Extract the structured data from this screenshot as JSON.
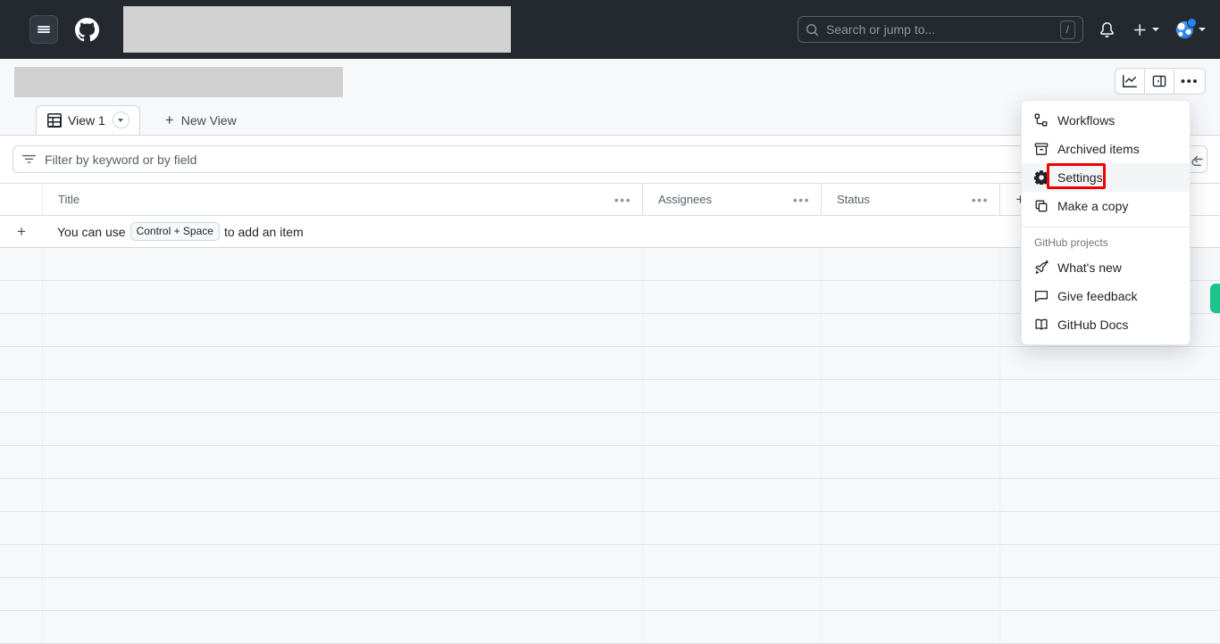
{
  "header": {
    "hamburger_icon": "hamburger-menu-icon",
    "logo_icon": "github-logo-icon",
    "org_name_redacted": "",
    "search": {
      "placeholder": "Search or jump to...",
      "shortcut": "/",
      "icon": "search-icon"
    },
    "notifications_icon": "bell-icon",
    "create_new_icon": "plus-icon",
    "avatar_icon": "avatar",
    "avatar_has_unread_dot": true
  },
  "project": {
    "name_redacted": "",
    "actions": [
      {
        "name": "insights-button",
        "icon": "chart-line-icon",
        "label": ""
      },
      {
        "name": "toggle-sidebar-button",
        "icon": "sidebar-expand-icon",
        "label": ""
      },
      {
        "name": "project-menu-button",
        "icon": "kebab-horizontal-icon",
        "label": "•••"
      }
    ]
  },
  "tabs": {
    "current": {
      "label": "View 1",
      "icon": "table-icon",
      "caret_icon": "chevron-down-icon"
    },
    "new_view_label": "New View",
    "new_view_icon": "plus-icon"
  },
  "filter": {
    "placeholder": "Filter by keyword or by field",
    "icon": "filter-icon",
    "undo_icon": "undo-arrow-icon"
  },
  "table": {
    "columns": [
      {
        "label": "Title",
        "menu_icon": "kebab-horizontal-icon",
        "dots": "•••"
      },
      {
        "label": "Assignees",
        "menu_icon": "kebab-horizontal-icon",
        "dots": "•••"
      },
      {
        "label": "Status",
        "menu_icon": "kebab-horizontal-icon",
        "dots": "•••"
      }
    ],
    "add_column_label": "+",
    "add_item_plus": "+",
    "hint": {
      "before": "You can use",
      "kbd": "Control + Space",
      "after": "to add an item"
    },
    "empty_row_count": 11
  },
  "menu": {
    "items": [
      {
        "label": "Workflows",
        "icon": "workflow-icon",
        "selected": false
      },
      {
        "label": "Archived items",
        "icon": "archive-icon",
        "selected": false
      },
      {
        "label": "Settings",
        "icon": "gear-icon",
        "selected": true
      },
      {
        "label": "Make a copy",
        "icon": "copy-icon",
        "selected": false
      }
    ],
    "section_label": "GitHub projects",
    "section_items": [
      {
        "label": "What's new",
        "icon": "rocket-icon"
      },
      {
        "label": "Give feedback",
        "icon": "comment-icon"
      },
      {
        "label": "GitHub Docs",
        "icon": "book-icon"
      }
    ]
  },
  "annotation": {
    "highlight_target": "Settings",
    "highlight_color": "#ee0000"
  },
  "colors": {
    "header_bg": "#24292f",
    "page_bg": "#ffffff",
    "subtle_bg": "#f6f8fa",
    "border": "#d0d7de",
    "toast_green": "#1bc48a",
    "accent_blue": "#2188ff"
  }
}
